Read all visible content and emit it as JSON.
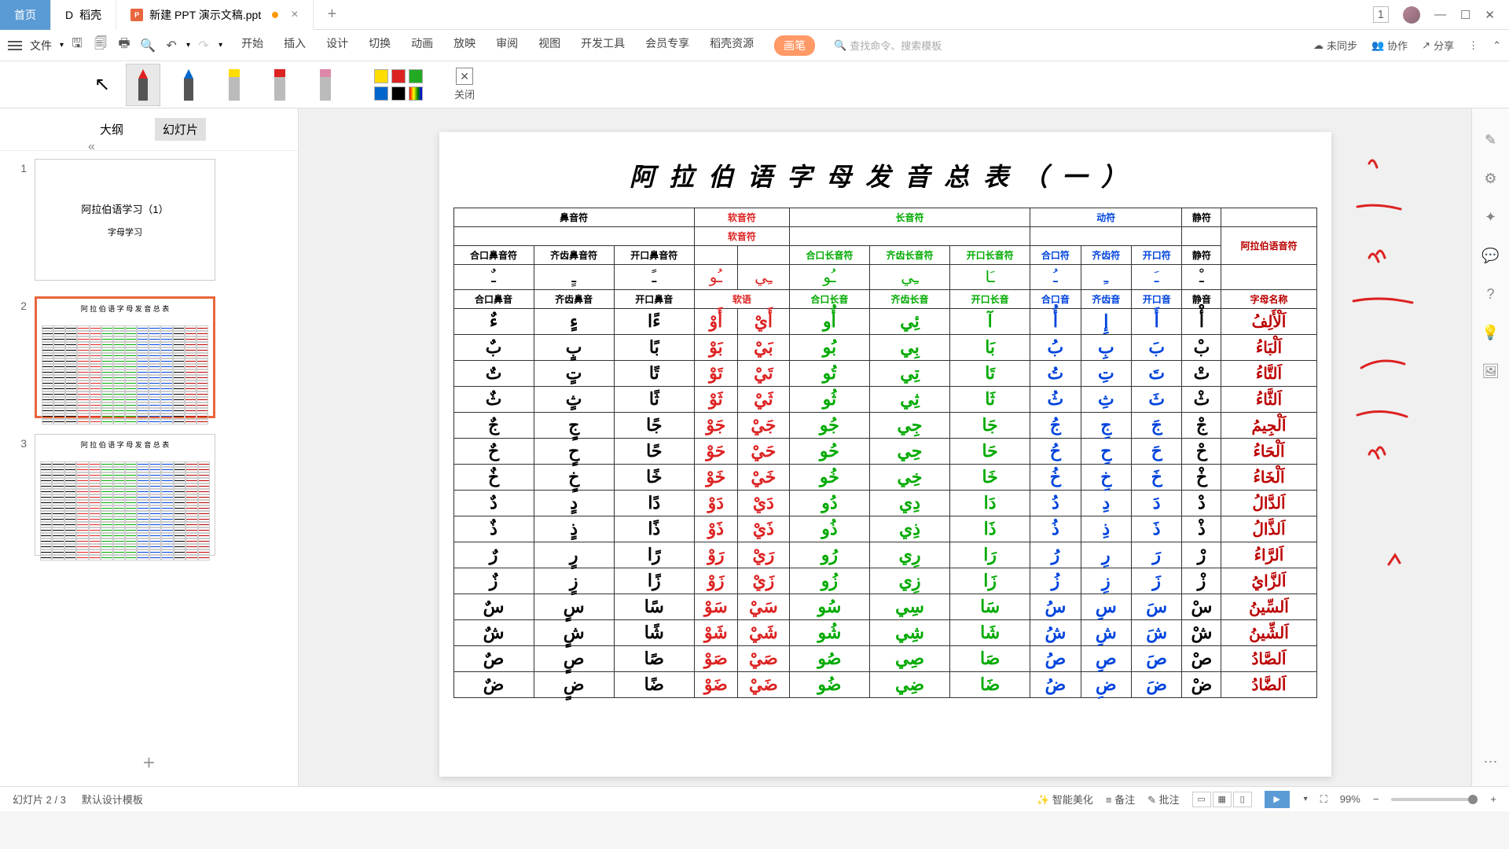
{
  "titlebar": {
    "home": "首页",
    "docer": "稻壳",
    "filename": "新建 PPT 演示文稿.ppt",
    "badge": "1"
  },
  "ribbon": {
    "file_menu": "文件",
    "tabs": [
      "开始",
      "插入",
      "设计",
      "切换",
      "动画",
      "放映",
      "审阅",
      "视图",
      "开发工具",
      "会员专享",
      "稻壳资源"
    ],
    "pen_tab": "画笔",
    "search_placeholder": "查找命令、搜索模板",
    "unsync": "未同步",
    "collab": "协作",
    "share": "分享"
  },
  "pen_toolbar": {
    "close": "关闭",
    "pens": [
      {
        "color": "#d22",
        "type": "pen",
        "selected": true
      },
      {
        "color": "#06c",
        "type": "pen"
      },
      {
        "color": "#fd0",
        "type": "hl"
      },
      {
        "color": "#d22",
        "type": "hl"
      },
      {
        "color": "#d8a",
        "type": "hl"
      }
    ],
    "palette_top": [
      "#fd0",
      "#d22",
      "#2a2"
    ],
    "palette_bot": [
      "#06c",
      "#000",
      "#rainbow"
    ]
  },
  "side": {
    "tab_outline": "大纲",
    "tab_slides": "幻灯片",
    "thumbs": [
      {
        "num": "1",
        "title": "阿拉伯语学习（1）",
        "sub": "字母学习"
      },
      {
        "num": "2",
        "type": "table"
      },
      {
        "num": "3",
        "type": "table"
      }
    ]
  },
  "slide": {
    "title": "阿拉伯语字母发音总表（一）"
  },
  "chart_data": {
    "type": "table",
    "group_headers": [
      {
        "label": "鼻音符",
        "span": 3,
        "cls": "grp-black"
      },
      {
        "label": "软音符",
        "span": 2,
        "cls": "grp-red"
      },
      {
        "label": "长音符",
        "span": 3,
        "cls": "grp-green"
      },
      {
        "label": "动符",
        "span": 3,
        "cls": "grp-blue"
      },
      {
        "label": "静符",
        "span": 1,
        "cls": "grp-black"
      },
      {
        "label": "",
        "span": 1,
        "cls": ""
      }
    ],
    "sub_group": [
      {
        "label": "",
        "span": 3,
        "cls": ""
      },
      {
        "label": "软音符",
        "span": 2,
        "cls": "grp-red"
      },
      {
        "label": "",
        "span": 3,
        "cls": ""
      },
      {
        "label": "",
        "span": 3,
        "cls": ""
      },
      {
        "label": "",
        "span": 1,
        "cls": ""
      },
      {
        "label": "阿拉伯语音符",
        "span": 1,
        "cls": "grp-title-red",
        "rowspan": 2
      }
    ],
    "col_headers_1": [
      {
        "t": "合口鼻音符",
        "c": "grp-black"
      },
      {
        "t": "齐齿鼻音符",
        "c": "grp-black"
      },
      {
        "t": "开口鼻音符",
        "c": "grp-black"
      },
      {
        "t": "",
        "c": ""
      },
      {
        "t": "",
        "c": ""
      },
      {
        "t": "合口长音符",
        "c": "grp-green"
      },
      {
        "t": "齐齿长音符",
        "c": "grp-green"
      },
      {
        "t": "开口长音符",
        "c": "grp-green"
      },
      {
        "t": "合口符",
        "c": "grp-blue"
      },
      {
        "t": "齐齿符",
        "c": "grp-blue"
      },
      {
        "t": "开口符",
        "c": "grp-blue"
      },
      {
        "t": "静符",
        "c": "grp-black"
      }
    ],
    "sample_row": [
      {
        "t": "ـٌ",
        "c": "grp-black"
      },
      {
        "t": "ـٍ",
        "c": "grp-black"
      },
      {
        "t": "ـً",
        "c": "grp-black"
      },
      {
        "t": "ـُو",
        "c": "grp-red"
      },
      {
        "t": "ـِي",
        "c": "grp-red"
      },
      {
        "t": "ـُو",
        "c": "grp-green"
      },
      {
        "t": "ـِي",
        "c": "grp-green"
      },
      {
        "t": "ـَا",
        "c": "grp-green"
      },
      {
        "t": "ـُ",
        "c": "grp-blue"
      },
      {
        "t": "ـِ",
        "c": "grp-blue"
      },
      {
        "t": "ـَ",
        "c": "grp-blue"
      },
      {
        "t": "ـْ",
        "c": "grp-black"
      },
      {
        "t": "",
        "c": ""
      }
    ],
    "col_headers_2": [
      {
        "t": "合口鼻音",
        "c": "grp-black"
      },
      {
        "t": "齐齿鼻音",
        "c": "grp-black"
      },
      {
        "t": "开口鼻音",
        "c": "grp-black"
      },
      {
        "t": "软语",
        "c": "grp-red",
        "span": 2
      },
      {
        "t": "合口长音",
        "c": "grp-green"
      },
      {
        "t": "齐齿长音",
        "c": "grp-green"
      },
      {
        "t": "开口长音",
        "c": "grp-green"
      },
      {
        "t": "合口音",
        "c": "grp-blue"
      },
      {
        "t": "齐齿音",
        "c": "grp-blue"
      },
      {
        "t": "开口音",
        "c": "grp-blue"
      },
      {
        "t": "静音",
        "c": "grp-black"
      },
      {
        "t": "字母名称",
        "c": "grp-title-red"
      }
    ],
    "rows": [
      {
        "name": "اَلْأَلِفُ",
        "cells": [
          "ءٌ",
          "ءٍ",
          "ءًا",
          "أَوْ",
          "أَيْ",
          "أُو",
          "ئِي",
          "آ",
          "أُ",
          "إِ",
          "أَ",
          "أْ"
        ]
      },
      {
        "name": "اَلْبَاءُ",
        "cells": [
          "بٌ",
          "بٍ",
          "بًا",
          "بَوْ",
          "بَيْ",
          "بُو",
          "بِي",
          "بَا",
          "بُ",
          "بِ",
          "بَ",
          "بْ"
        ]
      },
      {
        "name": "اَلتَّاءُ",
        "cells": [
          "تٌ",
          "تٍ",
          "تًا",
          "تَوْ",
          "تَيْ",
          "تُو",
          "تِي",
          "تَا",
          "تُ",
          "تِ",
          "تَ",
          "تْ"
        ]
      },
      {
        "name": "اَلثَّاءُ",
        "cells": [
          "ثٌ",
          "ثٍ",
          "ثًا",
          "ثَوْ",
          "ثَيْ",
          "ثُو",
          "ثِي",
          "ثَا",
          "ثُ",
          "ثِ",
          "ثَ",
          "ثْ"
        ]
      },
      {
        "name": "اَلْجِيمُ",
        "cells": [
          "جٌ",
          "جٍ",
          "جًا",
          "جَوْ",
          "جَيْ",
          "جُو",
          "جِي",
          "جَا",
          "جُ",
          "جِ",
          "جَ",
          "جْ"
        ]
      },
      {
        "name": "اَلْحَاءُ",
        "cells": [
          "حٌ",
          "حٍ",
          "حًا",
          "حَوْ",
          "حَيْ",
          "حُو",
          "حِي",
          "حَا",
          "حُ",
          "حِ",
          "حَ",
          "حْ"
        ]
      },
      {
        "name": "اَلْخَاءُ",
        "cells": [
          "خٌ",
          "خٍ",
          "خًا",
          "خَوْ",
          "خَيْ",
          "خُو",
          "خِي",
          "خَا",
          "خُ",
          "خِ",
          "خَ",
          "خْ"
        ]
      },
      {
        "name": "اَلدَّالُ",
        "cells": [
          "دٌ",
          "دٍ",
          "دًا",
          "دَوْ",
          "دَيْ",
          "دُو",
          "دِي",
          "دَا",
          "دُ",
          "دِ",
          "دَ",
          "دْ"
        ]
      },
      {
        "name": "اَلذَّالُ",
        "cells": [
          "ذٌ",
          "ذٍ",
          "ذًا",
          "ذَوْ",
          "ذَيْ",
          "ذُو",
          "ذِي",
          "ذَا",
          "ذُ",
          "ذِ",
          "ذَ",
          "ذْ"
        ]
      },
      {
        "name": "اَلرَّاءُ",
        "cells": [
          "رٌ",
          "رٍ",
          "رًا",
          "رَوْ",
          "رَيْ",
          "رُو",
          "رِي",
          "رَا",
          "رُ",
          "رِ",
          "رَ",
          "رْ"
        ]
      },
      {
        "name": "اَلزَّايُ",
        "cells": [
          "زٌ",
          "زٍ",
          "زًا",
          "زَوْ",
          "زَيْ",
          "زُو",
          "زِي",
          "زَا",
          "زُ",
          "زِ",
          "زَ",
          "زْ"
        ]
      },
      {
        "name": "اَلسِّينُ",
        "cells": [
          "سٌ",
          "سٍ",
          "سًا",
          "سَوْ",
          "سَيْ",
          "سُو",
          "سِي",
          "سَا",
          "سُ",
          "سِ",
          "سَ",
          "سْ"
        ]
      },
      {
        "name": "اَلشِّينُ",
        "cells": [
          "شٌ",
          "شٍ",
          "شًا",
          "شَوْ",
          "شَيْ",
          "شُو",
          "شِي",
          "شَا",
          "شُ",
          "شِ",
          "شَ",
          "شْ"
        ]
      },
      {
        "name": "اَلصَّادُ",
        "cells": [
          "صٌ",
          "صٍ",
          "صًا",
          "صَوْ",
          "صَيْ",
          "صُو",
          "صِي",
          "صَا",
          "صُ",
          "صِ",
          "صَ",
          "صْ"
        ]
      },
      {
        "name": "اَلضَّادُ",
        "cells": [
          "ضٌ",
          "ضٍ",
          "ضًا",
          "ضَوْ",
          "ضَيْ",
          "ضُو",
          "ضِي",
          "ضَا",
          "ضُ",
          "ضِ",
          "ضَ",
          "ضْ"
        ]
      }
    ],
    "col_classes": [
      "grp-black",
      "grp-black",
      "grp-black",
      "grp-red",
      "grp-red",
      "grp-green",
      "grp-green",
      "grp-green",
      "grp-blue",
      "grp-blue",
      "grp-blue",
      "grp-black"
    ]
  },
  "status": {
    "slide_pos": "幻灯片 2 / 3",
    "template": "默认设计模板",
    "beautify": "智能美化",
    "notes": "备注",
    "comments": "批注",
    "zoom": "99%"
  }
}
